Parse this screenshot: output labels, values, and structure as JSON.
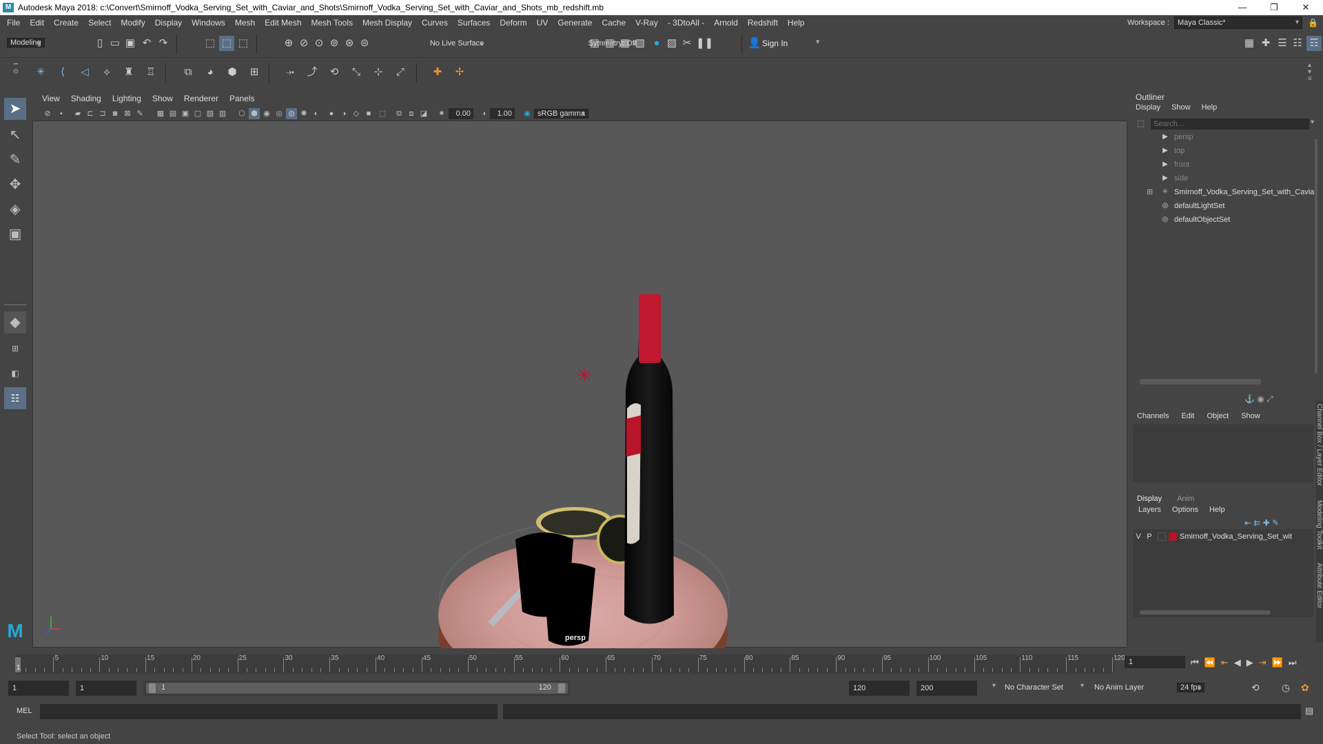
{
  "window": {
    "title": "Autodesk Maya 2018: c:\\Convert\\Smirnoff_Vodka_Serving_Set_with_Caviar_and_Shots\\Smirnoff_Vodka_Serving_Set_with_Caviar_and_Shots_mb_redshift.mb",
    "minimize": "—",
    "restore": "❐",
    "close": "✕"
  },
  "menus": [
    "File",
    "Edit",
    "Create",
    "Select",
    "Modify",
    "Display",
    "Windows",
    "Mesh",
    "Edit Mesh",
    "Mesh Tools",
    "Mesh Display",
    "Curves",
    "Surfaces",
    "Deform",
    "UV",
    "Generate",
    "Cache",
    "V-Ray",
    "- 3DtoAll -",
    "Arnold",
    "Redshift",
    "Help"
  ],
  "workspace": {
    "label": "Workspace :",
    "value": "Maya Classic*"
  },
  "statusline": {
    "mode": "Modeling",
    "live_surface": "No Live Surface",
    "symmetry": "Symmetry: Off",
    "sign_in": "Sign In"
  },
  "viewport": {
    "menus": [
      "View",
      "Shading",
      "Lighting",
      "Show",
      "Renderer",
      "Panels"
    ],
    "exposure": "0.00",
    "gamma": "1.00",
    "colorspace": "sRGB gamma",
    "camera": "persp"
  },
  "outliner": {
    "title": "Outliner",
    "menus": [
      "Display",
      "Show",
      "Help"
    ],
    "search_placeholder": "Search...",
    "items": [
      "persp",
      "top",
      "front",
      "side",
      "Smirnoff_Vodka_Serving_Set_with_Cavia",
      "defaultLightSet",
      "defaultObjectSet"
    ]
  },
  "channelbox": {
    "menus": [
      "Channels",
      "Edit",
      "Object",
      "Show"
    ]
  },
  "side_tabs": [
    "Channel Box / Layer Editor",
    "Modeling Toolkit",
    "Attribute Editor"
  ],
  "layers": {
    "tabs": [
      "Display",
      "Anim"
    ],
    "menus": [
      "Layers",
      "Options",
      "Help"
    ],
    "layer": {
      "v": "V",
      "p": "P",
      "name": "Smirnoff_Vodka_Serving_Set_wit",
      "color": "#b0152a"
    }
  },
  "timeline": {
    "ticks": [
      "5",
      "10",
      "15",
      "20",
      "25",
      "30",
      "35",
      "40",
      "45",
      "50",
      "55",
      "60",
      "65",
      "70",
      "75",
      "80",
      "85",
      "90",
      "95",
      "100",
      "105",
      "110",
      "115",
      "120"
    ],
    "first": "1",
    "current": "1"
  },
  "range": {
    "start": "1",
    "anim_start": "1",
    "slider_start": "1",
    "slider_end": "120",
    "end": "120",
    "anim_end": "200",
    "character_set": "No Character Set",
    "anim_layer": "No Anim Layer",
    "fps": "24 fps"
  },
  "cmd": {
    "lang": "MEL"
  },
  "help_line": "Select Tool: select an object"
}
